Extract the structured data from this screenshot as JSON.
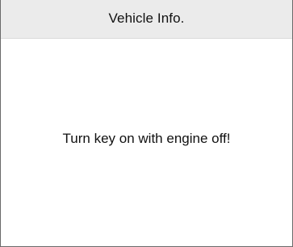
{
  "header": {
    "title": "Vehicle Info."
  },
  "main": {
    "message": "Turn key on with engine off!"
  },
  "colors": {
    "header_background": "#ebebeb",
    "border": "#6a6a6a",
    "text": "#111111",
    "background": "#ffffff"
  }
}
